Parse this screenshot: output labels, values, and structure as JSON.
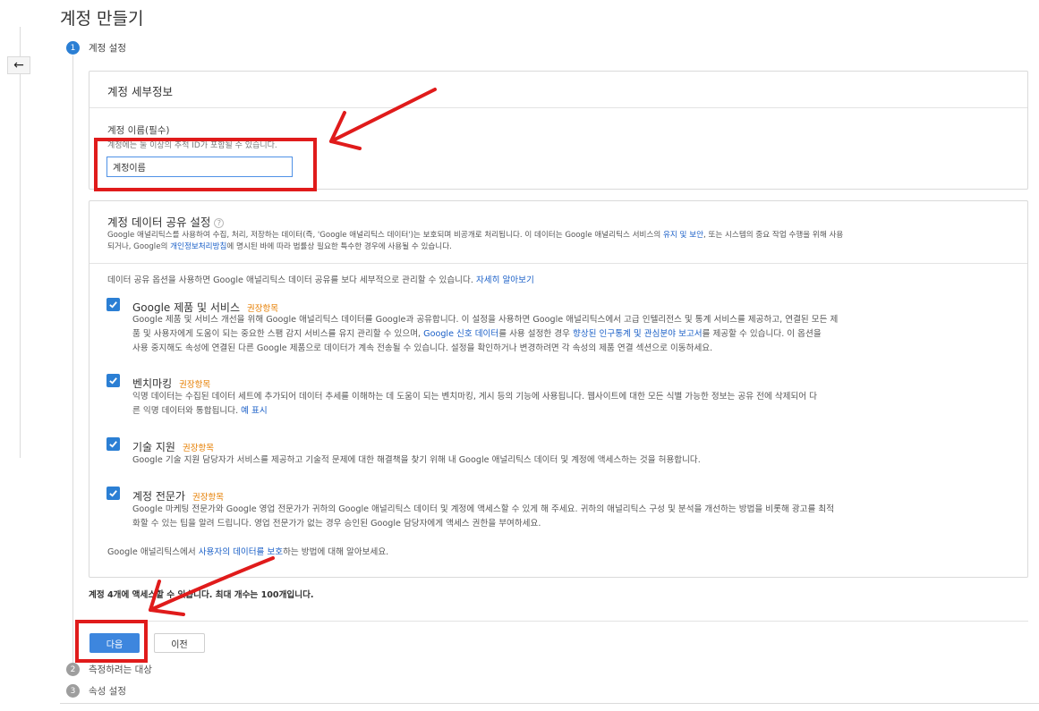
{
  "page": {
    "title": "계정 만들기"
  },
  "steps": [
    {
      "number": "1",
      "label": "계정 설정"
    },
    {
      "number": "2",
      "label": "측정하려는 대상"
    },
    {
      "number": "3",
      "label": "속성 설정"
    }
  ],
  "icons": {
    "back": "back-arrow-icon",
    "help": "help-icon",
    "check": "check-icon"
  },
  "account_details": {
    "title": "계정 세부정보",
    "name_label": "계정 이름(필수)",
    "name_hint": "계정에는 둘 이상의 추적 ID가 포함될 수 있습니다.",
    "name_value": "계정이름"
  },
  "data_sharing": {
    "title": "계정 데이터 공유 설정",
    "help_glyph": "?",
    "desc_a": "Google 애널리틱스를 사용하여 수집, 처리, 저장하는 데이터(즉, 'Google 애널리틱스 데이터')는 보호되며 비공개로 처리됩니다. 이 데이터는 Google 애널리틱스 서비스의 ",
    "desc_link1": "유지 및 보안",
    "desc_b": ", 또는 시스템의 중요 작업 수행을 위해 사용",
    "desc_c": "되거나, Google의 ",
    "desc_link2": "개인정보처리방침",
    "desc_d": "에 명시된 바에 따라 법률상 필요한 특수한 경우에 사용될 수 있습니다.",
    "intro_text": "데이터 공유 옵션을 사용하면 Google 애널리틱스 데이터 공유를 보다 세부적으로 관리할 수 있습니다. ",
    "intro_link": "자세히 알아보기",
    "options": [
      {
        "title": "Google 제품 및 서비스",
        "recommended": "권장항목",
        "line1": "Google 제품 및 서비스 개선을 위해 Google 애널리틱스 데이터를 Google과 공유합니다. 이 설정을 사용하면 Google 애널리틱스에서 고급 인텔리전스 및 통계 서비스를 제공하고, 연결된 모든 제",
        "line2a": "품 및 사용자에게 도움이 되는 중요한 스팸 감지 서비스를 유지 관리할 수 있으며, ",
        "link1": "Google 신호 데이터",
        "line2b": "를 사용 설정한 경우 ",
        "link2": "향상된 인구통계 및 관심분야 보고서",
        "line2c": "를 제공할 수 있습니다. 이 옵션을",
        "line3": "사용 중지해도 속성에 연결된 다른 Google 제품으로 데이터가 계속 전송될 수 있습니다. 설정을 확인하거나 변경하려면 각 속성의 제품 연결 섹션으로 이동하세요."
      },
      {
        "title": "벤치마킹",
        "recommended": "권장항목",
        "line1": "익명 데이터는 수집된 데이터 세트에 추가되어 데이터 추세를 이해하는 데 도움이 되는 벤치마킹, 게시 등의 기능에 사용됩니다. 웹사이트에 대한 모든 식별 가능한 정보는 공유 전에 삭제되어 다",
        "line2": "른 익명 데이터와 통합됩니다. ",
        "link": "예 표시"
      },
      {
        "title": "기술 지원",
        "recommended": "권장항목",
        "line1": "Google 기술 지원 담당자가 서비스를 제공하고 기술적 문제에 대한 해결책을 찾기 위해 내 Google 애널리틱스 데이터 및 계정에 액세스하는 것을 허용합니다."
      },
      {
        "title": "계정 전문가",
        "recommended": "권장항목",
        "line1": "Google 마케팅 전문가와 Google 영업 전문가가 귀하의 Google 애널리틱스 데이터 및 계정에 액세스할 수 있게 해 주세요. 귀하의 애널리틱스 구성 및 분석을 개선하는 방법을 비롯해 광고를 최적",
        "line2": "화할 수 있는 팁을 알려 드립니다. 영업 전문가가 없는 경우 승인된 Google 담당자에게 액세스 권한을 부여하세요."
      }
    ],
    "footer_a": "Google 애널리틱스에서 ",
    "footer_link": "사용자의 데이터를 보호",
    "footer_b": "하는 방법에 대해 알아보세요."
  },
  "account_limit_note": "계정 4개에 액세스할 수 있습니다. 최대 개수는 100개입니다.",
  "buttons": {
    "next": "다음",
    "previous": "이전"
  },
  "colors": {
    "accent": "#2b7fd4",
    "recommended": "#e67e00",
    "annotation": "#e01b1b",
    "link": "#1a5fc7"
  }
}
